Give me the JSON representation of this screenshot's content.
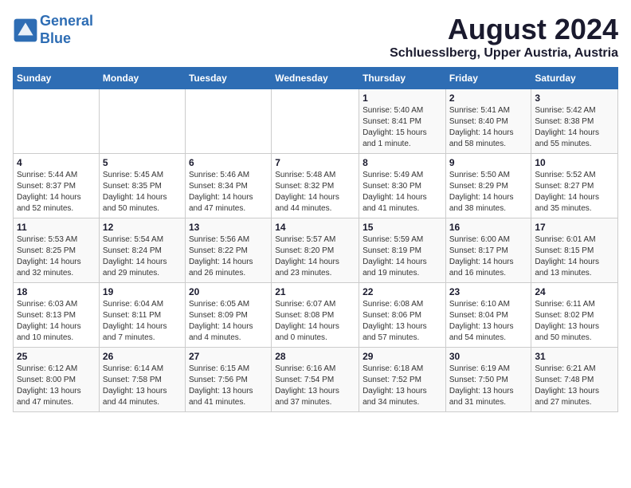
{
  "logo": {
    "line1": "General",
    "line2": "Blue"
  },
  "title": "August 2024",
  "subtitle": "Schluesslberg, Upper Austria, Austria",
  "days_header": [
    "Sunday",
    "Monday",
    "Tuesday",
    "Wednesday",
    "Thursday",
    "Friday",
    "Saturday"
  ],
  "weeks": [
    [
      {
        "day": "",
        "info": ""
      },
      {
        "day": "",
        "info": ""
      },
      {
        "day": "",
        "info": ""
      },
      {
        "day": "",
        "info": ""
      },
      {
        "day": "1",
        "info": "Sunrise: 5:40 AM\nSunset: 8:41 PM\nDaylight: 15 hours\nand 1 minute."
      },
      {
        "day": "2",
        "info": "Sunrise: 5:41 AM\nSunset: 8:40 PM\nDaylight: 14 hours\nand 58 minutes."
      },
      {
        "day": "3",
        "info": "Sunrise: 5:42 AM\nSunset: 8:38 PM\nDaylight: 14 hours\nand 55 minutes."
      }
    ],
    [
      {
        "day": "4",
        "info": "Sunrise: 5:44 AM\nSunset: 8:37 PM\nDaylight: 14 hours\nand 52 minutes."
      },
      {
        "day": "5",
        "info": "Sunrise: 5:45 AM\nSunset: 8:35 PM\nDaylight: 14 hours\nand 50 minutes."
      },
      {
        "day": "6",
        "info": "Sunrise: 5:46 AM\nSunset: 8:34 PM\nDaylight: 14 hours\nand 47 minutes."
      },
      {
        "day": "7",
        "info": "Sunrise: 5:48 AM\nSunset: 8:32 PM\nDaylight: 14 hours\nand 44 minutes."
      },
      {
        "day": "8",
        "info": "Sunrise: 5:49 AM\nSunset: 8:30 PM\nDaylight: 14 hours\nand 41 minutes."
      },
      {
        "day": "9",
        "info": "Sunrise: 5:50 AM\nSunset: 8:29 PM\nDaylight: 14 hours\nand 38 minutes."
      },
      {
        "day": "10",
        "info": "Sunrise: 5:52 AM\nSunset: 8:27 PM\nDaylight: 14 hours\nand 35 minutes."
      }
    ],
    [
      {
        "day": "11",
        "info": "Sunrise: 5:53 AM\nSunset: 8:25 PM\nDaylight: 14 hours\nand 32 minutes."
      },
      {
        "day": "12",
        "info": "Sunrise: 5:54 AM\nSunset: 8:24 PM\nDaylight: 14 hours\nand 29 minutes."
      },
      {
        "day": "13",
        "info": "Sunrise: 5:56 AM\nSunset: 8:22 PM\nDaylight: 14 hours\nand 26 minutes."
      },
      {
        "day": "14",
        "info": "Sunrise: 5:57 AM\nSunset: 8:20 PM\nDaylight: 14 hours\nand 23 minutes."
      },
      {
        "day": "15",
        "info": "Sunrise: 5:59 AM\nSunset: 8:19 PM\nDaylight: 14 hours\nand 19 minutes."
      },
      {
        "day": "16",
        "info": "Sunrise: 6:00 AM\nSunset: 8:17 PM\nDaylight: 14 hours\nand 16 minutes."
      },
      {
        "day": "17",
        "info": "Sunrise: 6:01 AM\nSunset: 8:15 PM\nDaylight: 14 hours\nand 13 minutes."
      }
    ],
    [
      {
        "day": "18",
        "info": "Sunrise: 6:03 AM\nSunset: 8:13 PM\nDaylight: 14 hours\nand 10 minutes."
      },
      {
        "day": "19",
        "info": "Sunrise: 6:04 AM\nSunset: 8:11 PM\nDaylight: 14 hours\nand 7 minutes."
      },
      {
        "day": "20",
        "info": "Sunrise: 6:05 AM\nSunset: 8:09 PM\nDaylight: 14 hours\nand 4 minutes."
      },
      {
        "day": "21",
        "info": "Sunrise: 6:07 AM\nSunset: 8:08 PM\nDaylight: 14 hours\nand 0 minutes."
      },
      {
        "day": "22",
        "info": "Sunrise: 6:08 AM\nSunset: 8:06 PM\nDaylight: 13 hours\nand 57 minutes."
      },
      {
        "day": "23",
        "info": "Sunrise: 6:10 AM\nSunset: 8:04 PM\nDaylight: 13 hours\nand 54 minutes."
      },
      {
        "day": "24",
        "info": "Sunrise: 6:11 AM\nSunset: 8:02 PM\nDaylight: 13 hours\nand 50 minutes."
      }
    ],
    [
      {
        "day": "25",
        "info": "Sunrise: 6:12 AM\nSunset: 8:00 PM\nDaylight: 13 hours\nand 47 minutes."
      },
      {
        "day": "26",
        "info": "Sunrise: 6:14 AM\nSunset: 7:58 PM\nDaylight: 13 hours\nand 44 minutes."
      },
      {
        "day": "27",
        "info": "Sunrise: 6:15 AM\nSunset: 7:56 PM\nDaylight: 13 hours\nand 41 minutes."
      },
      {
        "day": "28",
        "info": "Sunrise: 6:16 AM\nSunset: 7:54 PM\nDaylight: 13 hours\nand 37 minutes."
      },
      {
        "day": "29",
        "info": "Sunrise: 6:18 AM\nSunset: 7:52 PM\nDaylight: 13 hours\nand 34 minutes."
      },
      {
        "day": "30",
        "info": "Sunrise: 6:19 AM\nSunset: 7:50 PM\nDaylight: 13 hours\nand 31 minutes."
      },
      {
        "day": "31",
        "info": "Sunrise: 6:21 AM\nSunset: 7:48 PM\nDaylight: 13 hours\nand 27 minutes."
      }
    ]
  ]
}
